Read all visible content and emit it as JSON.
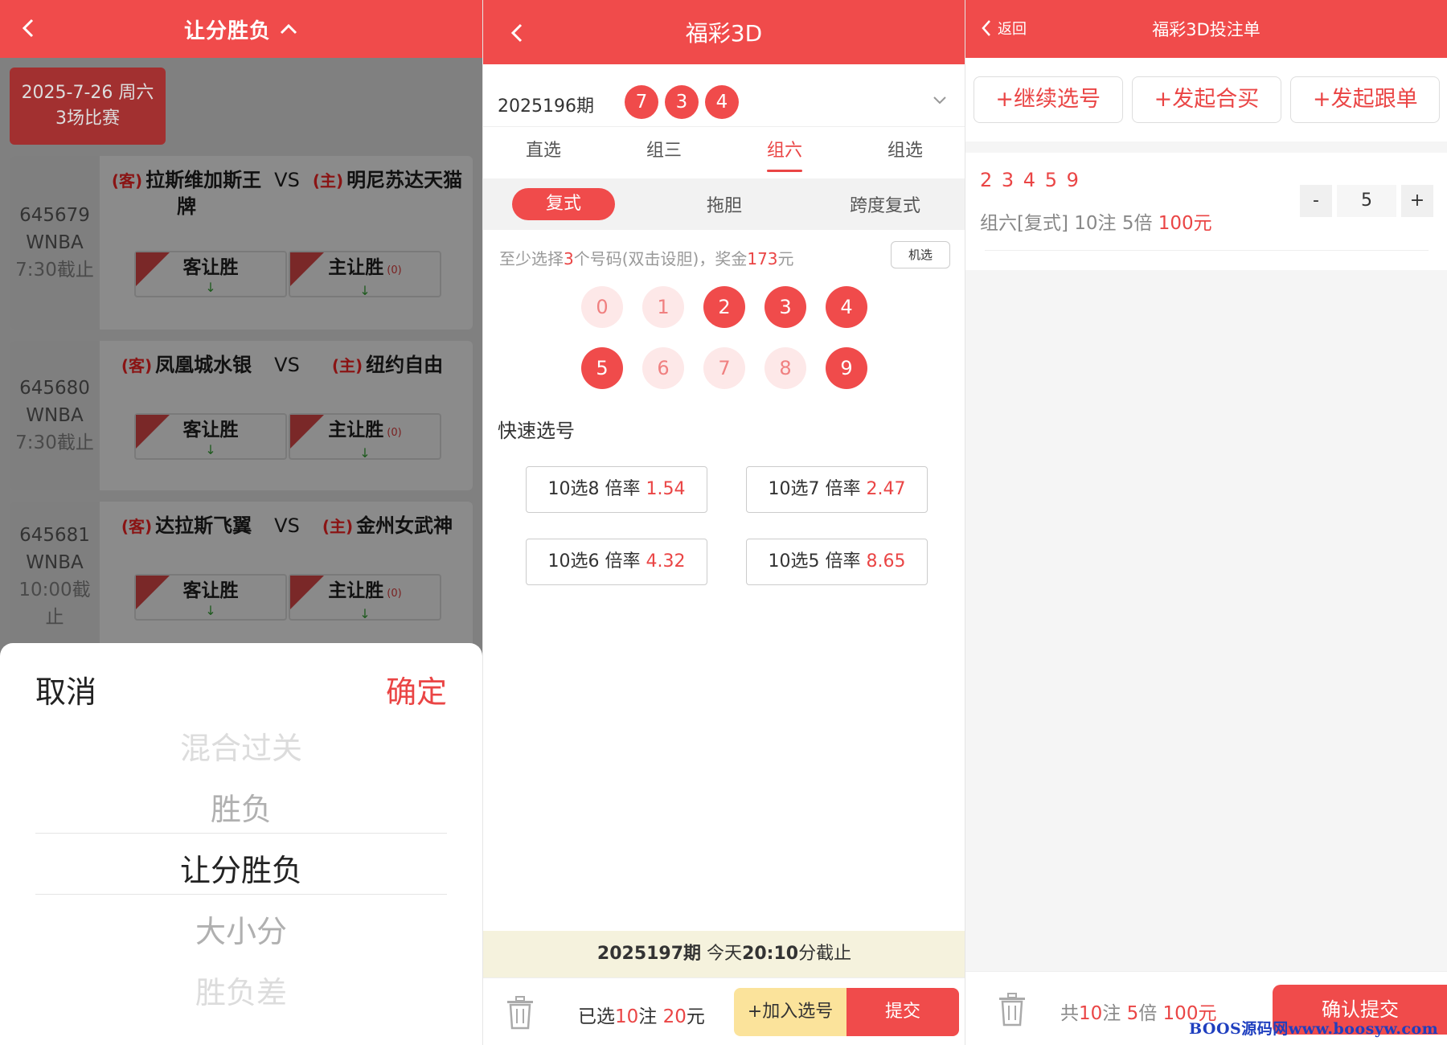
{
  "panel1": {
    "title": "让分胜负",
    "date_line1": "2025-7-26 周六",
    "date_line2": "3场比赛",
    "matches": [
      {
        "id": "645679",
        "league": "WNBA",
        "cutoff": "7:30截止",
        "away_tag": "(客)",
        "away": "拉斯维加斯王牌",
        "vs": "VS",
        "home_tag": "(主)",
        "home": "明尼苏达天猫",
        "bet_away": "客让胜",
        "bet_home": "主让胜",
        "home_odd": "(0)",
        "arrow": "↓"
      },
      {
        "id": "645680",
        "league": "WNBA",
        "cutoff": "7:30截止",
        "away_tag": "(客)",
        "away": "凤凰城水银",
        "vs": "VS",
        "home_tag": "(主)",
        "home": "纽约自由",
        "bet_away": "客让胜",
        "bet_home": "主让胜",
        "home_odd": "(0)",
        "arrow": "↓"
      },
      {
        "id": "645681",
        "league": "WNBA",
        "cutoff": "10:00截止",
        "away_tag": "(客)",
        "away": "达拉斯飞翼",
        "vs": "VS",
        "home_tag": "(主)",
        "home": "金州女武神",
        "bet_away": "客让胜",
        "bet_home": "主让胜",
        "home_odd": "(0)",
        "arrow": "↓"
      }
    ],
    "sheet": {
      "cancel": "取消",
      "confirm": "确定",
      "options": [
        "混合过关",
        "胜负",
        "让分胜负",
        "大小分",
        "胜负差"
      ],
      "selected": "让分胜负"
    }
  },
  "panel2": {
    "title": "福彩3D",
    "issue": "2025196期",
    "draw_balls": [
      "7",
      "3",
      "4"
    ],
    "tabs": [
      "直选",
      "组三",
      "组六",
      "组选"
    ],
    "active_tab": "组六",
    "modes": [
      "复式",
      "拖胆",
      "跨度复式"
    ],
    "active_mode": "复式",
    "hint": {
      "pre": "至少选择",
      "count": "3",
      "mid": "个号码(双击设胆)，奖金",
      "prize": "173",
      "post": "元"
    },
    "random_button": "机选",
    "numbers_row1": [
      "0",
      "1",
      "2",
      "3",
      "4"
    ],
    "numbers_row2": [
      "5",
      "6",
      "7",
      "8",
      "9"
    ],
    "selected_numbers": [
      "2",
      "3",
      "4",
      "5",
      "9"
    ],
    "quick_title": "快速选号",
    "quick": [
      {
        "label": "10选8",
        "rate_label": "倍率",
        "rate": "1.54"
      },
      {
        "label": "10选7",
        "rate_label": "倍率",
        "rate": "2.47"
      },
      {
        "label": "10选6",
        "rate_label": "倍率",
        "rate": "4.32"
      },
      {
        "label": "10选5",
        "rate_label": "倍率",
        "rate": "8.65"
      }
    ],
    "next_issue": "2025197期",
    "next_text": "今天",
    "next_time": "20:10",
    "next_suffix": "分截止",
    "footer": {
      "pre": "已选",
      "count": "10",
      "mid": "注 ",
      "amount": "20",
      "post": "元",
      "add": "+加入选号",
      "submit": "提交"
    }
  },
  "panel3": {
    "back": "返回",
    "title": "福彩3D投注单",
    "buttons": [
      "+继续选号",
      "+发起合买",
      "+发起跟单"
    ],
    "ticket_digits": "2 3 4 5 9",
    "ticket_desc_pre": "组六[复式] 10注 5倍 ",
    "ticket_amount": "100元",
    "stepper": {
      "minus": "-",
      "value": "5",
      "plus": "+"
    },
    "footer": {
      "pre": "共",
      "count": "10",
      "mid1": "注 ",
      "mult": "5",
      "mid2": "倍 ",
      "amount": "100元",
      "confirm": "确认提交"
    },
    "watermark": "BOOS源码网www.boosyw.com"
  },
  "colors": {
    "accent": "#f04b4b",
    "accent_text": "#ea4545"
  }
}
